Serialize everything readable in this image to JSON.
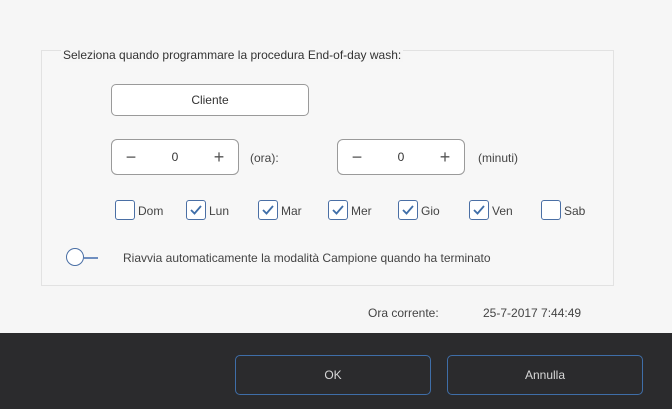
{
  "dialog": {
    "title": "Seleziona quando programmare la procedura End-of-day wash:",
    "client_button": "Cliente",
    "hours": {
      "minus": "−",
      "value": "0",
      "plus": "+",
      "unit": "(ora):"
    },
    "minutes": {
      "minus": "−",
      "value": "0",
      "plus": "+",
      "unit": "(minuti)"
    },
    "days": [
      {
        "label": "Dom",
        "checked": false
      },
      {
        "label": "Lun",
        "checked": true
      },
      {
        "label": "Mar",
        "checked": true
      },
      {
        "label": "Mer",
        "checked": true
      },
      {
        "label": "Gio",
        "checked": true
      },
      {
        "label": "Ven",
        "checked": true
      },
      {
        "label": "Sab",
        "checked": false
      }
    ],
    "restart_toggle": {
      "label": "Riavvia automaticamente la modalità Campione quando ha terminato",
      "on": false
    },
    "current_time_label": "Ora corrente:",
    "current_time_value": "25-7-2017 7:44:49",
    "ok_label": "OK",
    "cancel_label": "Annulla",
    "accent_color": "#3f6ea8"
  }
}
